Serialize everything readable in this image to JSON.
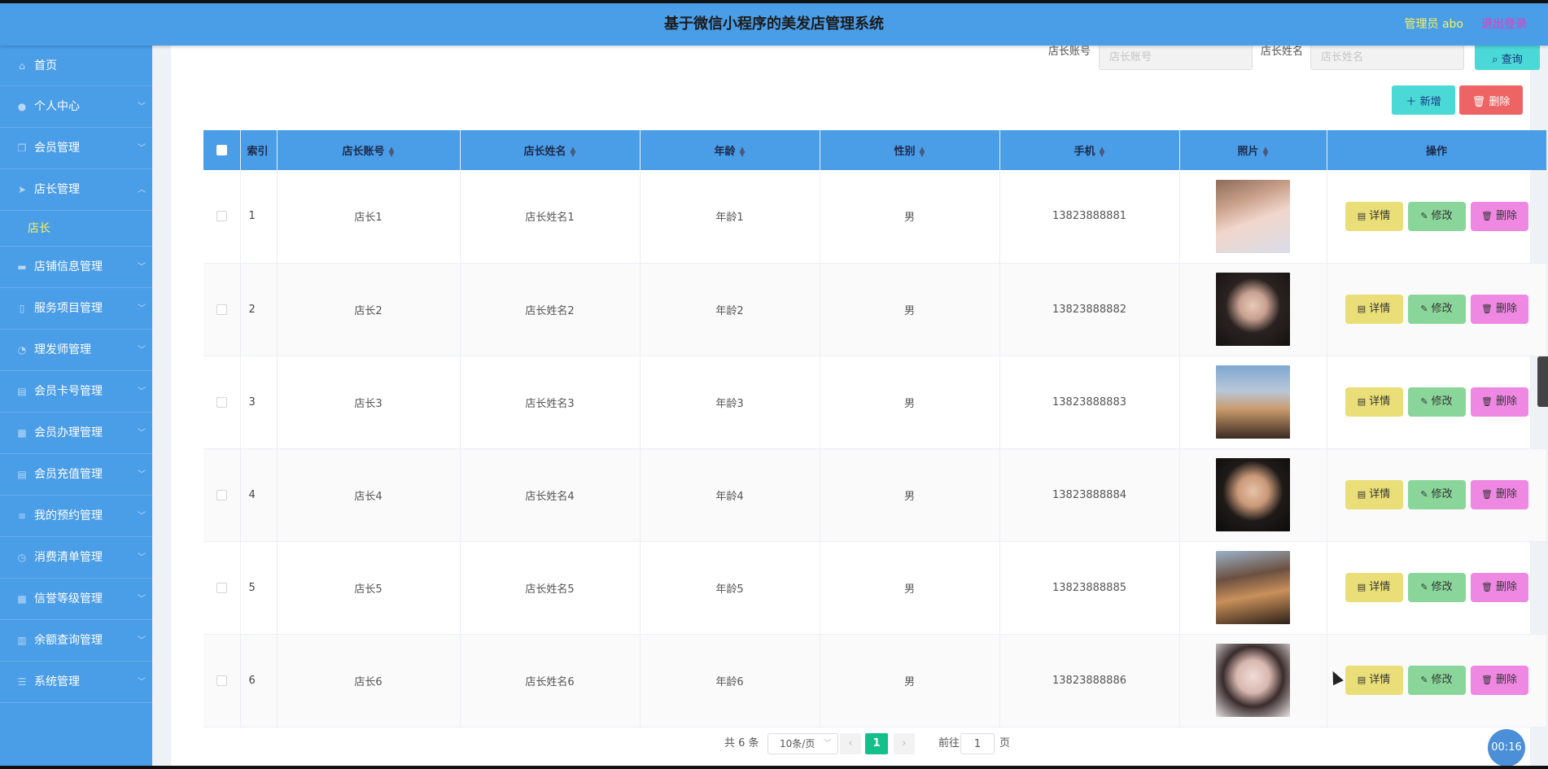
{
  "header": {
    "title": "基于微信小程序的美发店管理系统",
    "admin": "管理员 abo",
    "logout": "退出登录"
  },
  "sidebar": {
    "items": [
      {
        "label": "首页",
        "icon": "home-icon",
        "glyph": "⌂"
      },
      {
        "label": "个人中心",
        "icon": "user-icon",
        "glyph": "●"
      },
      {
        "label": "会员管理",
        "icon": "copy-icon",
        "glyph": "❐"
      },
      {
        "label": "店长管理",
        "icon": "send-icon",
        "glyph": "➤"
      },
      {
        "label": "店铺信息管理",
        "icon": "chat-icon",
        "glyph": "▬"
      },
      {
        "label": "服务项目管理",
        "icon": "phone-icon",
        "glyph": "▯"
      },
      {
        "label": "理发师管理",
        "icon": "power-icon",
        "glyph": "◔"
      },
      {
        "label": "会员卡号管理",
        "icon": "clipboard-icon",
        "glyph": "▤"
      },
      {
        "label": "会员办理管理",
        "icon": "grid-icon",
        "glyph": "▦"
      },
      {
        "label": "会员充值管理",
        "icon": "clipboard-icon",
        "glyph": "▤"
      },
      {
        "label": "我的预约管理",
        "icon": "sliders-icon",
        "glyph": "≡"
      },
      {
        "label": "消费清单管理",
        "icon": "clock-icon",
        "glyph": "◷"
      },
      {
        "label": "信誉等级管理",
        "icon": "dashboard-icon",
        "glyph": "▦"
      },
      {
        "label": "余额查询管理",
        "icon": "bank-icon",
        "glyph": "▥"
      },
      {
        "label": "系统管理",
        "icon": "menu-icon",
        "glyph": "☰"
      }
    ],
    "submenu": "店长"
  },
  "search": {
    "account_label": "店长账号",
    "account_placeholder": "店长账号",
    "name_label": "店长姓名",
    "name_placeholder": "店长姓名",
    "query_label": "查询",
    "query_icon": "search-icon"
  },
  "toolbar": {
    "add_label": "新增",
    "delete_label": "删除"
  },
  "table": {
    "columns": [
      "索引",
      "店长账号",
      "店长姓名",
      "年龄",
      "性别",
      "手机",
      "照片",
      "操作"
    ],
    "rows": [
      {
        "index": "1",
        "account": "店长1",
        "name": "店长姓名1",
        "age": "年龄1",
        "gender": "男",
        "phone": "13823888881"
      },
      {
        "index": "2",
        "account": "店长2",
        "name": "店长姓名2",
        "age": "年龄2",
        "gender": "男",
        "phone": "13823888882"
      },
      {
        "index": "3",
        "account": "店长3",
        "name": "店长姓名3",
        "age": "年龄3",
        "gender": "男",
        "phone": "13823888883"
      },
      {
        "index": "4",
        "account": "店长4",
        "name": "店长姓名4",
        "age": "年龄4",
        "gender": "男",
        "phone": "13823888884"
      },
      {
        "index": "5",
        "account": "店长5",
        "name": "店长姓名5",
        "age": "年龄5",
        "gender": "男",
        "phone": "13823888885"
      },
      {
        "index": "6",
        "account": "店长6",
        "name": "店长姓名6",
        "age": "年龄6",
        "gender": "男",
        "phone": "13823888886"
      }
    ],
    "actions": {
      "detail": "详情",
      "edit": "修改",
      "delete": "删除"
    }
  },
  "pagination": {
    "total": "共 6 条",
    "page_size": "10条/页",
    "current": "1",
    "goto_label": "前往",
    "goto_value": "1",
    "goto_unit": "页"
  },
  "timer": "00:16",
  "colors": {
    "primary": "#4a9de7",
    "accent_yellow": "#f6f35a",
    "logout_pink": "#e63cbf",
    "detail": "#e9de78",
    "edit": "#8ad69a",
    "delete": "#ef88e3",
    "page_active": "#14c08a"
  }
}
